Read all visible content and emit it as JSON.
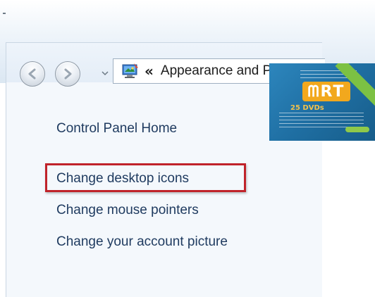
{
  "navigation": {
    "back_icon": "back-arrow-icon",
    "forward_icon": "forward-arrow-icon",
    "history_icon": "chevron-down-icon"
  },
  "address_bar": {
    "location_icon": "control-panel-icon",
    "overflow_symbol": "«",
    "crumb": "Appearance and Pe"
  },
  "sidebar": {
    "home_link": "Control Panel Home",
    "links": [
      "Change desktop icons",
      "Change mouse pointers",
      "Change your account picture"
    ]
  },
  "annotation": {
    "highlight_color": "#c0232a"
  },
  "watermark": {
    "logo": "ᗰRT",
    "subtitle": "25 DVDs",
    "accent_color": "#f2a81d"
  }
}
